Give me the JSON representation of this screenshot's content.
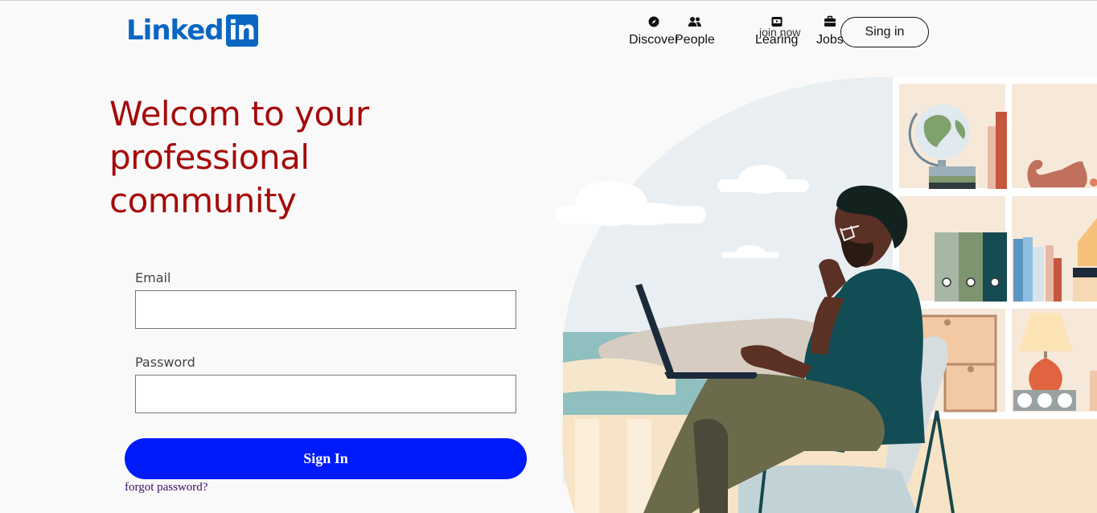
{
  "logo": {
    "word": "Linked",
    "box": "in"
  },
  "nav": {
    "items": [
      {
        "label": "Discover",
        "icon": "compass-icon"
      },
      {
        "label": "People",
        "icon": "people-icon"
      },
      {
        "label": "Learing",
        "icon": "video-icon"
      },
      {
        "label": "Jobs",
        "icon": "briefcase-icon"
      }
    ],
    "join_now": "join now",
    "sign_in": "Sing in"
  },
  "hero": {
    "headline": "Welcom to your professional community"
  },
  "form": {
    "email_label": "Email",
    "email_value": "",
    "password_label": "Password",
    "password_value": "",
    "submit": "Sign In",
    "forgot": "forgot password?"
  },
  "colors": {
    "brand": "#0a66c2",
    "headline": "#a50a0a",
    "submit_button": "#001bfa",
    "forgot_link": "#3a0f63"
  }
}
